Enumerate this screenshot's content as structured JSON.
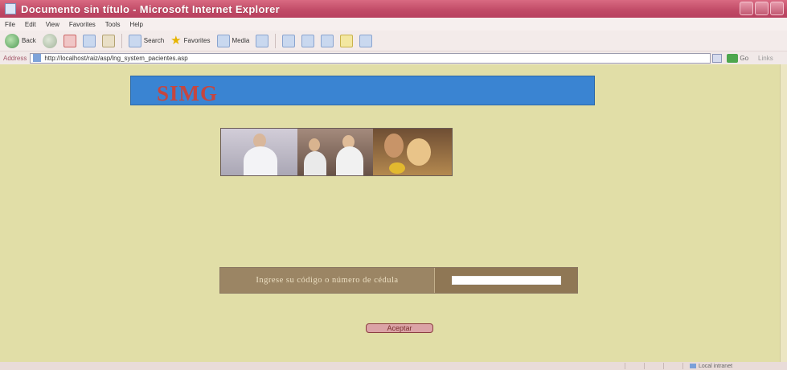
{
  "window": {
    "title": "Documento sin título - Microsoft Internet Explorer"
  },
  "menu": {
    "items": [
      "File",
      "Edit",
      "View",
      "Favorites",
      "Tools",
      "Help"
    ]
  },
  "toolbar": {
    "back_label": "Back",
    "search_label": "Search",
    "favorites_label": "Favorites",
    "media_label": "Media"
  },
  "address": {
    "label": "Address",
    "url": "http://localhost/raiz/asp/lng_system_pacientes.asp",
    "go_label": "Go",
    "links_label": "Links"
  },
  "page": {
    "banner_title": "SIMG",
    "form_label": "Ingrese su código o número de cédula",
    "form_input_value": "",
    "accept_label": "Aceptar"
  },
  "status": {
    "zone_label": "Local intranet"
  },
  "colors": {
    "titlebar": "#c04a66",
    "content_bg": "#e1dea7",
    "banner_bg": "#3a84d2",
    "banner_text": "#c6463f",
    "form_bg": "#9b8564"
  }
}
